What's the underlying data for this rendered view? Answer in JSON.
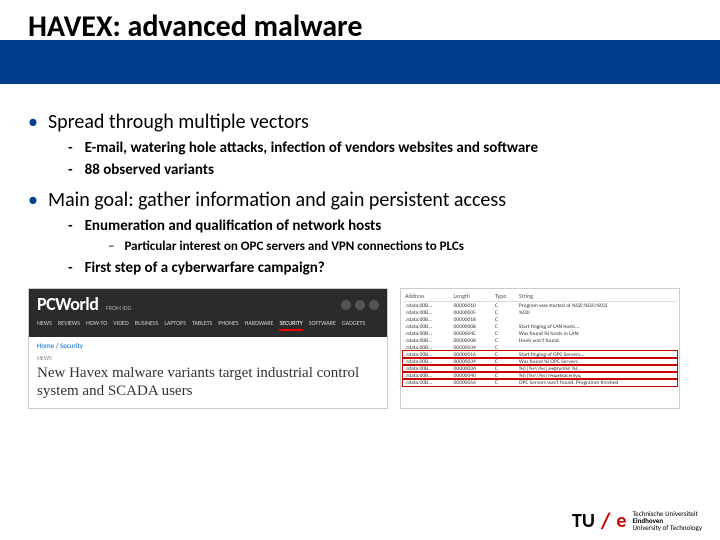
{
  "title": "HAVEX: advanced malware",
  "bullets": {
    "b1": "Spread through multiple vectors",
    "b1a": "E-mail, watering hole attacks, infection of vendors websites and software",
    "b1b": "88 observed variants",
    "b2": "Main goal: gather information and gain persistent access",
    "b2a": "Enumeration and qualification of network hosts",
    "b2a1": "Particular interest on OPC servers and VPN connections to PLCs",
    "b2b": "First step of a cyberwarfare campaign?"
  },
  "pcworld": {
    "brand": "PCWorld",
    "edition": "FROM IDG",
    "nav": [
      "NEWS",
      "REVIEWS",
      "HOW-TO",
      "VIDEO",
      "BUSINESS",
      "LAPTOPS",
      "TABLETS",
      "PHONES",
      "HARDWARE",
      "SECURITY",
      "SOFTWARE",
      "GADGETS"
    ],
    "crumb": "Home / Security",
    "tag": "NEWS",
    "headline": "New Havex malware variants target industrial control system and SCADA users"
  },
  "table": {
    "headers": [
      "Address",
      "Length",
      "Type",
      "String"
    ],
    "rows": [
      [
        ".rdata:00B...",
        "00000010",
        "C",
        "Program was started at %02i:%02i:%02i"
      ],
      [
        ".rdata:00B...",
        "00000005",
        "C",
        "%02i"
      ],
      [
        ".rdata:00B...",
        "00000018",
        "C",
        ""
      ],
      [
        ".rdata:00B...",
        "00000008",
        "C",
        "Start finging of LAN hosts..."
      ],
      [
        ".rdata:00B...",
        "0000004C",
        "C",
        "Was found %i hosts in LAN:"
      ],
      [
        ".rdata:00B...",
        "00000008",
        "C",
        "Hosts was't found."
      ],
      [
        ".rdata:00B...",
        "00000034",
        "C",
        ""
      ],
      [
        ".rdata:00B...",
        "00000016",
        "C",
        "Start finging of OPC Servers..."
      ],
      [
        ".rdata:00B...",
        "00000034",
        "C",
        "Was found %i OPC Servers."
      ],
      [
        ".rdata:00B...",
        "0000003A",
        "C",
        "%i) [%s\\\\%s] ачфтул%i: %i:..."
      ],
      [
        ".rdata:00B...",
        "00000040",
        "C",
        "%i) [%s\\\\%s] пчшмкасмлуц"
      ],
      [
        ".rdata:00B...",
        "00000056",
        "C",
        "OPC Servers was't found. Programm finished"
      ]
    ]
  },
  "footer": {
    "tu": "TU",
    "e": "e",
    "l1": "Technische Universiteit",
    "l2": "Eindhoven",
    "l3": "University of Technology"
  }
}
